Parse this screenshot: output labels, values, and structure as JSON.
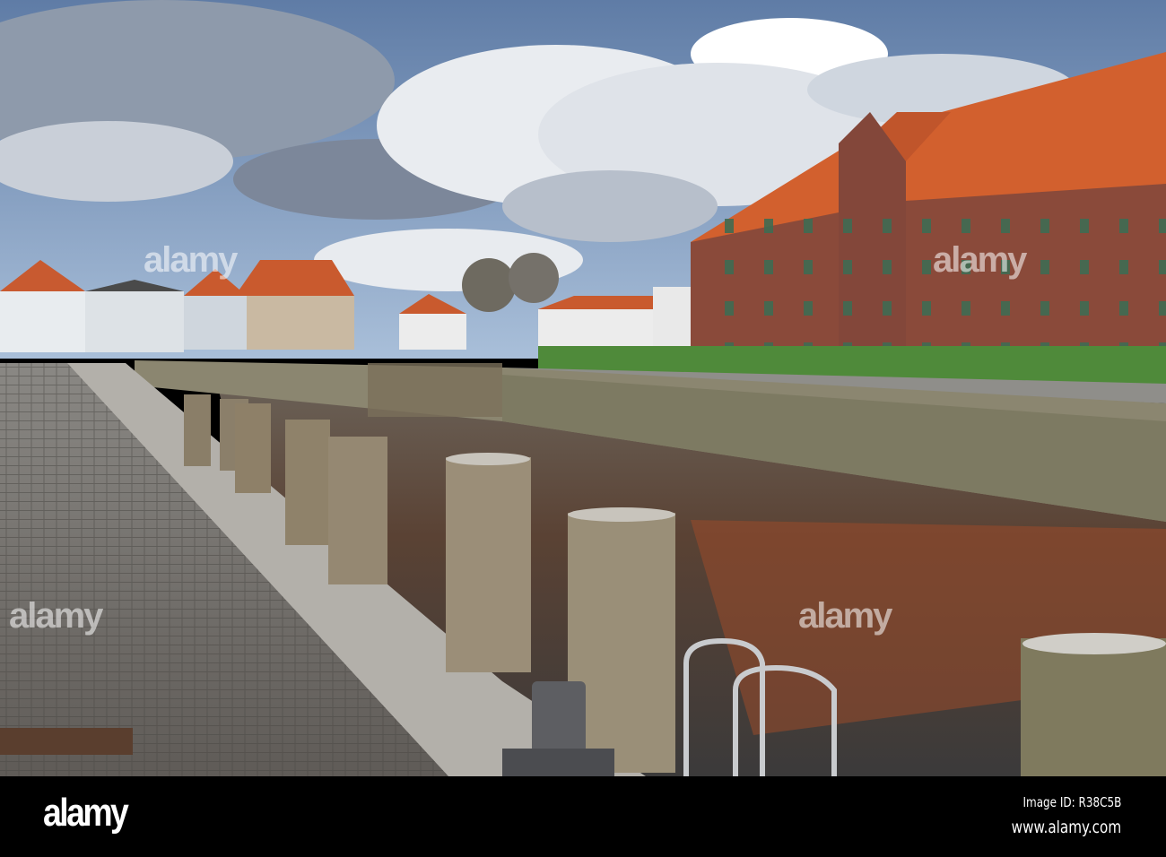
{
  "photo": {
    "subject": "harbour-quay-with-brick-warehouse",
    "colors": {
      "sky": "#7f9cc4",
      "roof": "#d2602e",
      "brick": "#8a4a3a",
      "water": "#4a3c30",
      "cobble": "#6e6a66",
      "grass": "#4f8a3a"
    }
  },
  "watermark": {
    "text": "alamy"
  },
  "footer": {
    "logo": "alamy",
    "image_id": "Image ID: R38C5B",
    "website": "www.alamy.com"
  }
}
